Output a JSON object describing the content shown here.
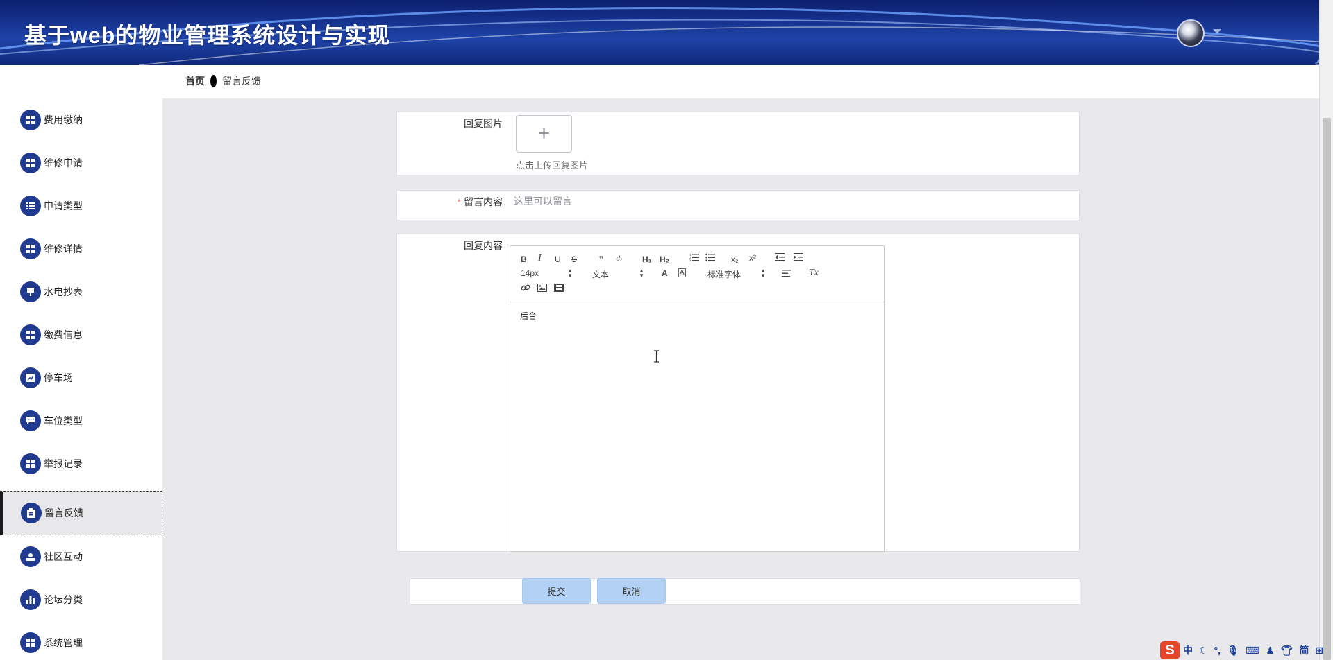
{
  "header": {
    "title": "基于web的物业管理系统设计与实现",
    "avatar_icon": "user-avatar",
    "caret_icon": "caret-down"
  },
  "breadcrumb": {
    "home": "首页",
    "current": "留言反馈"
  },
  "sidebar": {
    "items": [
      {
        "label": "费用缴纳",
        "icon": "grid-icon"
      },
      {
        "label": "维修申请",
        "icon": "grid-icon"
      },
      {
        "label": "申请类型",
        "icon": "list-icon"
      },
      {
        "label": "维修详情",
        "icon": "grid-icon"
      },
      {
        "label": "水电抄表",
        "icon": "stamp-icon"
      },
      {
        "label": "缴费信息",
        "icon": "grid-icon"
      },
      {
        "label": "停车场",
        "icon": "chart-icon"
      },
      {
        "label": "车位类型",
        "icon": "chat-icon"
      },
      {
        "label": "举报记录",
        "icon": "grid-icon"
      },
      {
        "label": "留言反馈",
        "icon": "clipboard-icon",
        "active": true
      },
      {
        "label": "社区互动",
        "icon": "user-icon"
      },
      {
        "label": "论坛分类",
        "icon": "bar-chart-icon"
      },
      {
        "label": "系统管理",
        "icon": "grid-icon"
      }
    ]
  },
  "form": {
    "reply_image_label": "回复图片",
    "upload_symbol": "+",
    "upload_tip": "点击上传回复图片",
    "message_label": "留言内容",
    "message_required_mark": "*",
    "message_placeholder": "这里可以留言",
    "reply_content_label": "回复内容",
    "editor": {
      "font_size": "14px",
      "text_style": "文本",
      "font_family": "标准字体",
      "content": "后台",
      "toolbar": {
        "bold": "B",
        "italic": "I",
        "underline": "U",
        "strike": "S",
        "quote": "❞",
        "code": "‹/›",
        "h1": "H₁",
        "h2": "H₂",
        "sub": "x₂",
        "sup": "x²",
        "color": "A",
        "bg": "A",
        "clear": "Tx"
      }
    },
    "submit_label": "提交",
    "cancel_label": "取消"
  },
  "ime": {
    "logo": "S",
    "lang": "中",
    "mode": "简"
  },
  "colors": {
    "header_bg": "#1a3a9a",
    "menu_icon_bg": "#1f3a8f",
    "button_bg": "#b3d1f5",
    "required": "#f56c6c"
  }
}
